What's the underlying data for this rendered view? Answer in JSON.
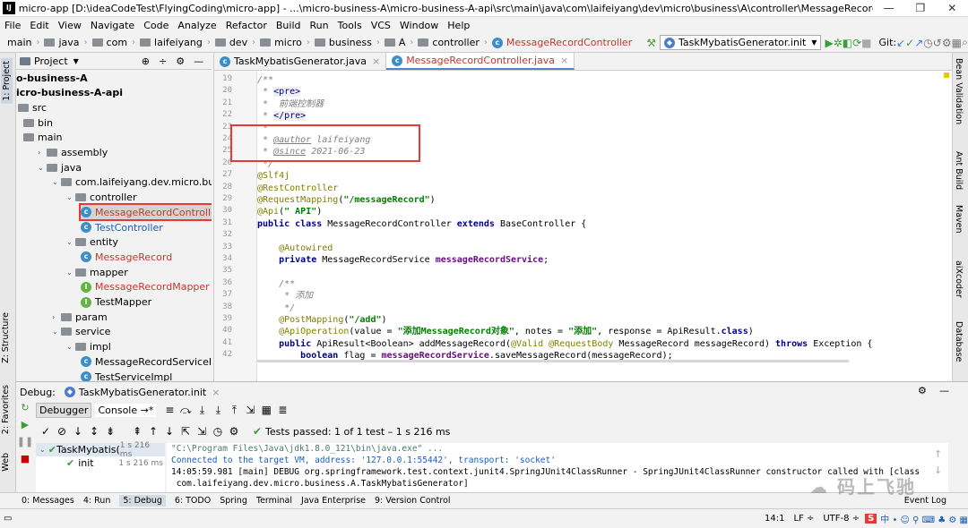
{
  "titlebar": {
    "title": "micro-app [D:\\ideaCodeTest\\FlyingCoding\\micro-app] - ...\\micro-business-A\\micro-business-A-api\\src\\main\\java\\com\\laifeiyang\\dev\\micro\\business\\A\\controller\\MessageRecordController.java [micro-busi...",
    "min": "—",
    "max": "❐",
    "close": "✕"
  },
  "menu": [
    "File",
    "Edit",
    "View",
    "Navigate",
    "Code",
    "Analyze",
    "Refactor",
    "Build",
    "Run",
    "Tools",
    "VCS",
    "Window",
    "Help"
  ],
  "breadcrumb": [
    "main",
    "java",
    "com",
    "laifeiyang",
    "dev",
    "micro",
    "business",
    "A",
    "controller",
    "MessageRecordController"
  ],
  "runconfig": "TaskMybatisGenerator.init",
  "git_label": "Git:",
  "project": {
    "title": "Project",
    "items": [
      {
        "label": "o-business-A",
        "x": 0,
        "bold": true
      },
      {
        "label": "icro-business-A-api",
        "x": 0,
        "bold": true
      },
      {
        "label": "src",
        "x": 2,
        "type": "folder"
      },
      {
        "label": "bin",
        "x": 8,
        "type": "folder"
      },
      {
        "label": "main",
        "x": 8,
        "type": "folder"
      },
      {
        "label": "assembly",
        "x": 24,
        "type": "folder",
        "arrow": "›"
      },
      {
        "label": "java",
        "x": 24,
        "type": "folder",
        "arrow": "⌄"
      },
      {
        "label": "com.laifeiyang.dev.micro.business.A",
        "x": 40,
        "type": "folder",
        "arrow": "⌄"
      },
      {
        "label": "controller",
        "x": 56,
        "type": "folder",
        "arrow": "⌄"
      },
      {
        "label": "MessageRecordController",
        "x": 72,
        "type": "class",
        "selected": true
      },
      {
        "label": "TestController",
        "x": 72,
        "type": "class"
      },
      {
        "label": "entity",
        "x": 56,
        "type": "folder",
        "arrow": "⌄"
      },
      {
        "label": "MessageRecord",
        "x": 72,
        "type": "class"
      },
      {
        "label": "mapper",
        "x": 56,
        "type": "folder",
        "arrow": "⌄"
      },
      {
        "label": "MessageRecordMapper",
        "x": 72,
        "type": "iface"
      },
      {
        "label": "TestMapper",
        "x": 72,
        "type": "iface"
      },
      {
        "label": "param",
        "x": 40,
        "type": "folder",
        "arrow": "›"
      },
      {
        "label": "service",
        "x": 40,
        "type": "folder",
        "arrow": "⌄"
      },
      {
        "label": "impl",
        "x": 56,
        "type": "folder",
        "arrow": "⌄"
      },
      {
        "label": "MessageRecordServiceIm",
        "x": 72,
        "type": "class"
      },
      {
        "label": "TestServiceImpl",
        "x": 72,
        "type": "class"
      }
    ]
  },
  "tabs": [
    "TaskMybatisGenerator.java",
    "MessageRecordController.java"
  ],
  "code": {
    "start": 19,
    "lines": [
      [
        [
          "/**",
          "cmt"
        ]
      ],
      [
        [
          " * ",
          "cmt"
        ],
        [
          "<pre>",
          "tag"
        ]
      ],
      [
        [
          " *  前端控制器",
          "cmt"
        ]
      ],
      [
        [
          " * ",
          "cmt"
        ],
        [
          "</pre>",
          "tag"
        ]
      ],
      [
        [
          " *",
          "cmt"
        ]
      ],
      [
        [
          " * ",
          "cmt"
        ],
        [
          "@author",
          "doc"
        ],
        [
          " laifeiyang",
          "cmt"
        ]
      ],
      [
        [
          " * ",
          "cmt"
        ],
        [
          "@since",
          "doc"
        ],
        [
          " 2021-06-23",
          "cmt"
        ]
      ],
      [
        [
          " */",
          "cmt"
        ]
      ],
      [
        [
          "@Slf4j",
          "ann"
        ]
      ],
      [
        [
          "@RestController",
          "ann"
        ]
      ],
      [
        [
          "@RequestMapping",
          "ann"
        ],
        [
          "(",
          "p"
        ],
        [
          "\"/messageRecord\"",
          "str"
        ],
        [
          ")",
          "p"
        ]
      ],
      [
        [
          "@Api",
          "ann"
        ],
        [
          "(",
          "p"
        ],
        [
          "\" API\"",
          "str"
        ],
        [
          ")",
          "p"
        ]
      ],
      [
        [
          "public class ",
          "kw"
        ],
        [
          "MessageRecordController ",
          "p"
        ],
        [
          "extends ",
          "kw"
        ],
        [
          "BaseController {",
          "p"
        ]
      ],
      [
        [
          "",
          "p"
        ]
      ],
      [
        [
          "    ",
          "p"
        ],
        [
          "@Autowired",
          "ann"
        ]
      ],
      [
        [
          "    ",
          "p"
        ],
        [
          "private ",
          "kw"
        ],
        [
          "MessageRecordService ",
          "p"
        ],
        [
          "messageRecordService",
          "fld"
        ],
        [
          ";",
          "p"
        ]
      ],
      [
        [
          "",
          "p"
        ]
      ],
      [
        [
          "    /**",
          "cmt"
        ]
      ],
      [
        [
          "     * 添加",
          "cmt"
        ]
      ],
      [
        [
          "     */",
          "cmt"
        ]
      ],
      [
        [
          "    ",
          "p"
        ],
        [
          "@PostMapping",
          "ann"
        ],
        [
          "(",
          "p"
        ],
        [
          "\"/add\"",
          "str"
        ],
        [
          ")",
          "p"
        ]
      ],
      [
        [
          "    ",
          "p"
        ],
        [
          "@ApiOperation",
          "ann"
        ],
        [
          "(value = ",
          "p"
        ],
        [
          "\"添加MessageRecord对象\"",
          "str"
        ],
        [
          ", notes = ",
          "p"
        ],
        [
          "\"添加\"",
          "str"
        ],
        [
          ", response = ApiResult.",
          "p"
        ],
        [
          "class",
          "kw"
        ],
        [
          ")",
          "p"
        ]
      ],
      [
        [
          "    ",
          "p"
        ],
        [
          "public ",
          "kw"
        ],
        [
          "ApiResult<Boolean> addMessageRecord(",
          "p"
        ],
        [
          "@Valid @RequestBody ",
          "ann"
        ],
        [
          "MessageRecord messageRecord) ",
          "p"
        ],
        [
          "throws ",
          "kw"
        ],
        [
          "Exception {",
          "p"
        ]
      ],
      [
        [
          "        ",
          "p"
        ],
        [
          "boolean ",
          "kw"
        ],
        [
          "flag = ",
          "p"
        ],
        [
          "messageRecordService",
          "fld"
        ],
        [
          ".saveMessageRecord(messageRecord);",
          "p"
        ]
      ]
    ]
  },
  "right_tabs": [
    "Bean Validation",
    "Ant Build",
    "Maven",
    "aiXcoder",
    "Database"
  ],
  "left_tabs": [
    "1: Project",
    "Z: Structure",
    "2: Favorites",
    "Web"
  ],
  "debug": {
    "title": "Debug:",
    "config": "TaskMybatisGenerator.init",
    "sub_tabs": [
      "Debugger",
      "Console"
    ],
    "status": "Tests passed: 1 of 1 test – 1 s 216 ms",
    "tree": [
      {
        "label": "TaskMybatis(",
        "time": "1 s 216 ms"
      },
      {
        "label": "init",
        "time": "1 s 216 ms"
      }
    ],
    "console": [
      "\"C:\\Program Files\\Java\\jdk1.8.0_121\\bin\\java.exe\" ...",
      "Connected to the target VM, address: '127.0.0.1:55442', transport: 'socket'",
      "14:05:59.981 [main] DEBUG org.springframework.test.context.junit4.SpringJUnit4ClassRunner - SpringJUnit4ClassRunner constructor called with [class",
      " com.laifeiyang.dev.micro.business.A.TaskMybatisGenerator]"
    ]
  },
  "bottom_tabs": [
    "0: Messages",
    "4: Run",
    "5: Debug",
    "6: TODO",
    "Spring",
    "Terminal",
    "Java Enterprise",
    "9: Version Control"
  ],
  "event_log": "Event Log",
  "status": {
    "pos": "14:1",
    "lf": "LF ÷",
    "enc": "UTF-8 ÷"
  },
  "watermark": "码上飞驰"
}
